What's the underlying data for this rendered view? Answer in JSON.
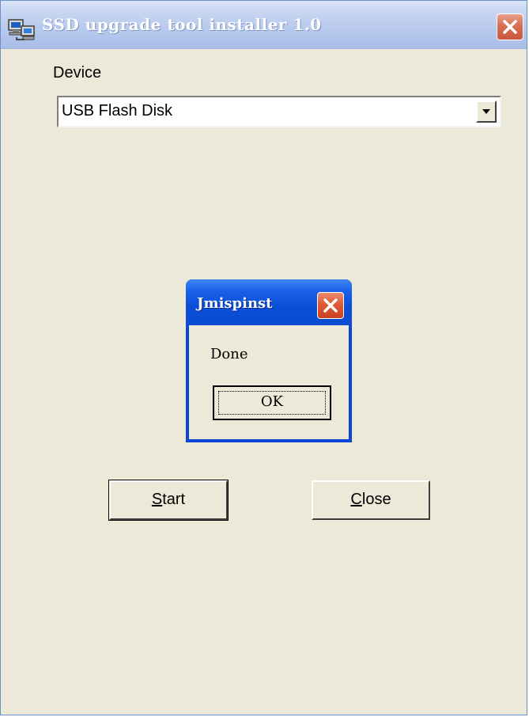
{
  "window": {
    "title": "SSD upgrade tool installer 1.0",
    "app_icon": "computer-network-icon",
    "close_icon": "close-icon"
  },
  "device": {
    "label": "Device",
    "selected_value": "USB Flash Disk",
    "dropdown_icon": "chevron-down-icon"
  },
  "buttons": {
    "start": {
      "mnemonic": "S",
      "rest": "tart"
    },
    "close": {
      "mnemonic": "C",
      "rest": "lose"
    }
  },
  "dialog": {
    "title": "Jmispinst",
    "message": "Done",
    "ok_label": "OK",
    "close_icon": "close-icon"
  },
  "colors": {
    "window_bg": "#ece9d8",
    "dialog_titlebar": "#0a4ed8",
    "close_button": "#d86f55"
  }
}
